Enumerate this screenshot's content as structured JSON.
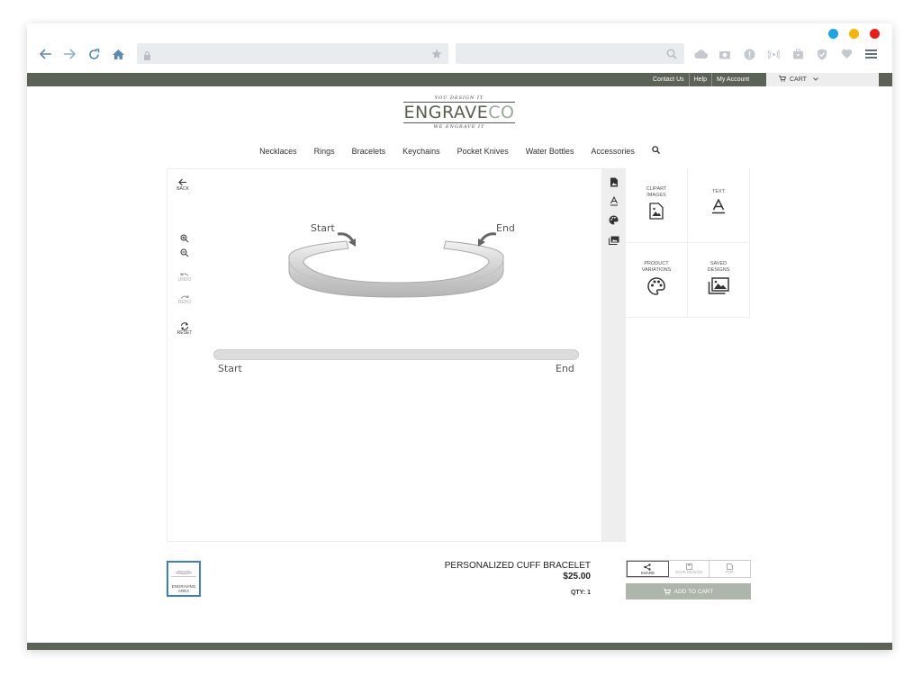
{
  "colors": {
    "dot1": "#1aa6e9",
    "dot2": "#f7b500",
    "dot3": "#ee1c14",
    "brand_dark": "#5b6358",
    "button_disabled": "#aeb5ab"
  },
  "header": {
    "links": [
      "Contact Us",
      "Help",
      "My Account"
    ],
    "cart_label": "CART"
  },
  "logo": {
    "tagline_top": "YOU DESIGN IT",
    "word_main": "ENGRAVE",
    "word_accent": "CO",
    "tagline_bottom": "WE ENGRAVE IT"
  },
  "nav": {
    "items": [
      "Necklaces",
      "Rings",
      "Bracelets",
      "Keychains",
      "Pocket Knives",
      "Water Bottles",
      "Accessories"
    ]
  },
  "tools": {
    "back": "BACK",
    "undo": "UNDO",
    "redo": "REDO",
    "reset": "RESET"
  },
  "canvas": {
    "start_label": "Start",
    "end_label": "End",
    "bar_start": "Start",
    "bar_end": "End"
  },
  "panel": {
    "clipart": "CLIPART IMAGES",
    "text": "TEXT",
    "variations": "PRODUCT VARIATIONS",
    "saved": "SAVED DESIGNS"
  },
  "thumb": {
    "label": "ENGRAVING AREA"
  },
  "product": {
    "name": "PERSONALIZED CUFF BRACELET",
    "price": "$25.00",
    "qty": "QTY: 1"
  },
  "actions": {
    "share": "SHARE",
    "save": "SAVE DESIGN",
    "pdf": "PDF",
    "add_to_cart": "ADD TO CART"
  }
}
